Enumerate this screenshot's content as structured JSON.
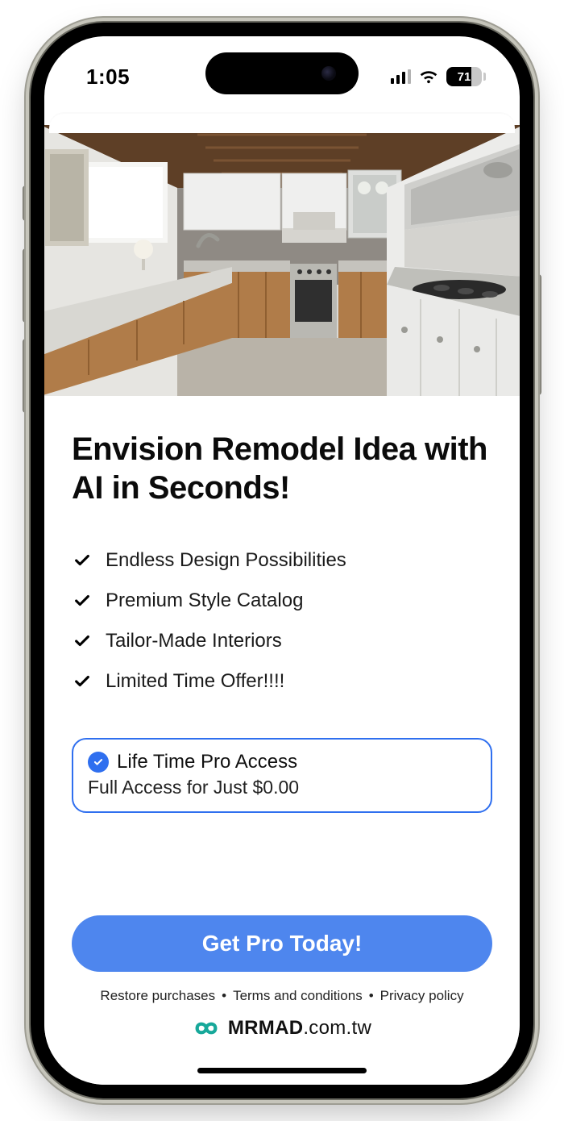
{
  "status": {
    "time": "1:05",
    "battery": "71"
  },
  "hero": {
    "alt": "Kitchen interior render"
  },
  "main": {
    "title": "Envision Remodel Idea with AI in Seconds!",
    "features": [
      "Endless Design Possibilities",
      "Premium Style Catalog",
      "Tailor-Made Interiors",
      "Limited Time Offer!!!!"
    ],
    "plan": {
      "name": "Life Time Pro Access",
      "desc": "Full Access for Just $0.00"
    },
    "cta": "Get Pro Today!",
    "legal": {
      "restore": "Restore purchases",
      "terms": "Terms and conditions",
      "privacy": "Privacy policy"
    }
  },
  "watermark": {
    "brand": "MRMAD",
    "suffix": ".com.tw"
  }
}
